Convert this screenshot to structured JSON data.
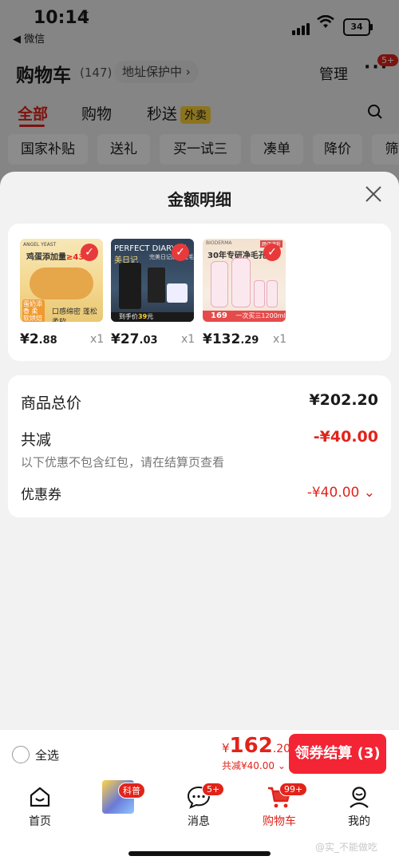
{
  "status_bar": {
    "time": "10:14",
    "back_app": "◀ 微信",
    "battery": "34"
  },
  "header": {
    "title": "购物车",
    "count": "(147)",
    "address_protection": "地址保护中 ›",
    "manage": "管理",
    "more_badge": "5+"
  },
  "tabs": [
    {
      "label": "全部",
      "active": true
    },
    {
      "label": "购物"
    },
    {
      "label": "秒送",
      "tag": "外卖"
    }
  ],
  "filter_chips": [
    "国家补贴",
    "送礼",
    "买一试三",
    "凑单",
    "降价",
    "筛"
  ],
  "sheet": {
    "title": "金额明细",
    "products": [
      {
        "price_int": "¥2",
        "price_dec": ".88",
        "qty": "x1",
        "image": {
          "tag": "鸡蛋添加量",
          "tag_pct": "≥43",
          "brand": "ANGEL YEAST",
          "badge": "蛋奶添香 柔软烘焙",
          "caption": "口感绵密 蓬松柔软"
        }
      },
      {
        "price_int": "¥27",
        "price_dec": ".03",
        "qty": "x1",
        "image": {
          "brand": "PERFECT DIARY",
          "brand_cn": "完美日记",
          "sub": "完美日记防晕睫毛膏",
          "caption_left": "到手价",
          "caption_price": "39",
          "caption_unit": "元"
        }
      },
      {
        "price_int": "¥132",
        "price_dec": ".29",
        "qty": "x1",
        "image": {
          "top_brand": "BIODERMA",
          "top_badge": "跨店满折",
          "headline": "30年专研净毛孔 一",
          "bottom_price": "169",
          "bottom_text": "一次买三1200ml"
        }
      }
    ],
    "summary": {
      "total_label": "商品总价",
      "total_value": "¥202.20",
      "discount_label": "共减",
      "discount_value": "-¥40.00",
      "note": "以下优惠不包含红包，请在结算页查看",
      "coupon_label": "优惠券",
      "coupon_value": "-¥40.00"
    }
  },
  "checkout": {
    "select_all": "全选",
    "total_symbol": "¥",
    "total_int": "162",
    "total_dec": ".20",
    "discount_line": "共减¥40.00",
    "button": "领券结算 (3)"
  },
  "tabbar": [
    {
      "label": "首页",
      "icon": "home-icon"
    },
    {
      "label": "",
      "icon": "kepu-image",
      "badge": "科普"
    },
    {
      "label": "消息",
      "icon": "message-icon",
      "badge": "5+"
    },
    {
      "label": "购物车",
      "icon": "cart-icon",
      "badge": "99+",
      "active": true
    },
    {
      "label": "我的",
      "icon": "profile-icon"
    }
  ],
  "watermark": "@实_不能做吃",
  "colors": {
    "accent": "#e2231a",
    "button": "#f32434",
    "sheet_bg": "#f2f2f2"
  }
}
